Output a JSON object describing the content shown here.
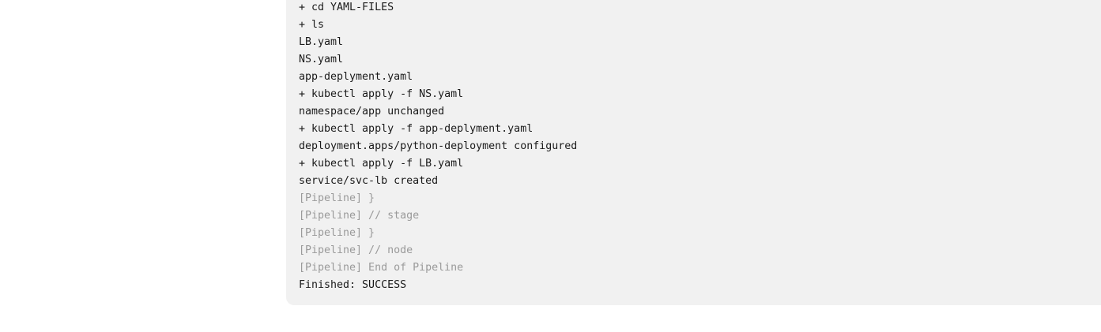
{
  "console": {
    "lines": [
      {
        "text": "+ cd YAML-FILES",
        "kind": "cmd"
      },
      {
        "text": "+ ls",
        "kind": "cmd"
      },
      {
        "text": "LB.yaml",
        "kind": "out"
      },
      {
        "text": "NS.yaml",
        "kind": "out"
      },
      {
        "text": "app-deplyment.yaml",
        "kind": "out"
      },
      {
        "text": "+ kubectl apply -f NS.yaml",
        "kind": "cmd"
      },
      {
        "text": "namespace/app unchanged",
        "kind": "out"
      },
      {
        "text": "+ kubectl apply -f app-deplyment.yaml",
        "kind": "cmd"
      },
      {
        "text": "deployment.apps/python-deployment configured",
        "kind": "out"
      },
      {
        "text": "+ kubectl apply -f LB.yaml",
        "kind": "cmd"
      },
      {
        "text": "service/svc-lb created",
        "kind": "out"
      },
      {
        "text": "[Pipeline] }",
        "kind": "pipeline"
      },
      {
        "text": "[Pipeline] // stage",
        "kind": "pipeline"
      },
      {
        "text": "[Pipeline] }",
        "kind": "pipeline"
      },
      {
        "text": "[Pipeline] // node",
        "kind": "pipeline"
      },
      {
        "text": "[Pipeline] End of Pipeline",
        "kind": "pipeline"
      },
      {
        "text": "Finished: SUCCESS",
        "kind": "status"
      }
    ]
  },
  "colors": {
    "panel_background": "#f1f1f1",
    "text": "#1a1a1a",
    "pipeline_text": "#9a9a9a"
  }
}
